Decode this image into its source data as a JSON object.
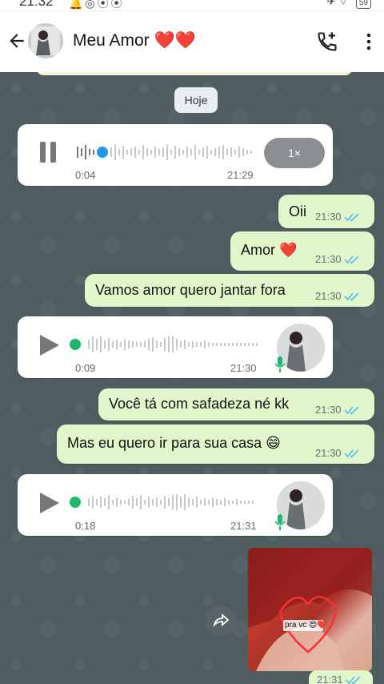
{
  "status_bar": {
    "time": "21:32",
    "battery": "59"
  },
  "header": {
    "contact_name": "Meu Amor ❤️❤️"
  },
  "date_chip": "Hoje",
  "messages": [
    {
      "type": "voice",
      "direction": "in",
      "elapsed": "0:04",
      "time": "21:29",
      "speed": "1×",
      "state": "playing"
    },
    {
      "type": "text",
      "direction": "out",
      "text": "Oii",
      "time": "21:30"
    },
    {
      "type": "text",
      "direction": "out",
      "text": "Amor ❤️",
      "time": "21:30"
    },
    {
      "type": "text",
      "direction": "out",
      "text": "Vamos amor quero jantar fora",
      "time": "21:30"
    },
    {
      "type": "voice",
      "direction": "in",
      "elapsed": "0:09",
      "time": "21:30",
      "state": "paused"
    },
    {
      "type": "text",
      "direction": "out",
      "text": "Você tá com safadeza né kk",
      "time": "21:30"
    },
    {
      "type": "text",
      "direction": "out",
      "text": "Mas eu quero ir para sua casa 😄",
      "time": "21:30"
    },
    {
      "type": "voice",
      "direction": "in",
      "elapsed": "0:18",
      "time": "21:31",
      "state": "paused"
    },
    {
      "type": "image",
      "direction": "out",
      "caption": "pra vc 😍❤️",
      "time": "21:31"
    }
  ],
  "colors": {
    "incoming": "#ffffff",
    "outgoing": "#e1f7cb",
    "read_ticks": "#53bdeb",
    "voice_played": "#1fb86b",
    "voice_progress": "#2196f3",
    "chat_bg": "#4f5d61"
  },
  "icons": [
    "back-arrow-icon",
    "add-call-icon",
    "more-vert-icon",
    "pause-icon",
    "play-icon",
    "mic-icon",
    "double-check-icon",
    "forward-icon"
  ]
}
